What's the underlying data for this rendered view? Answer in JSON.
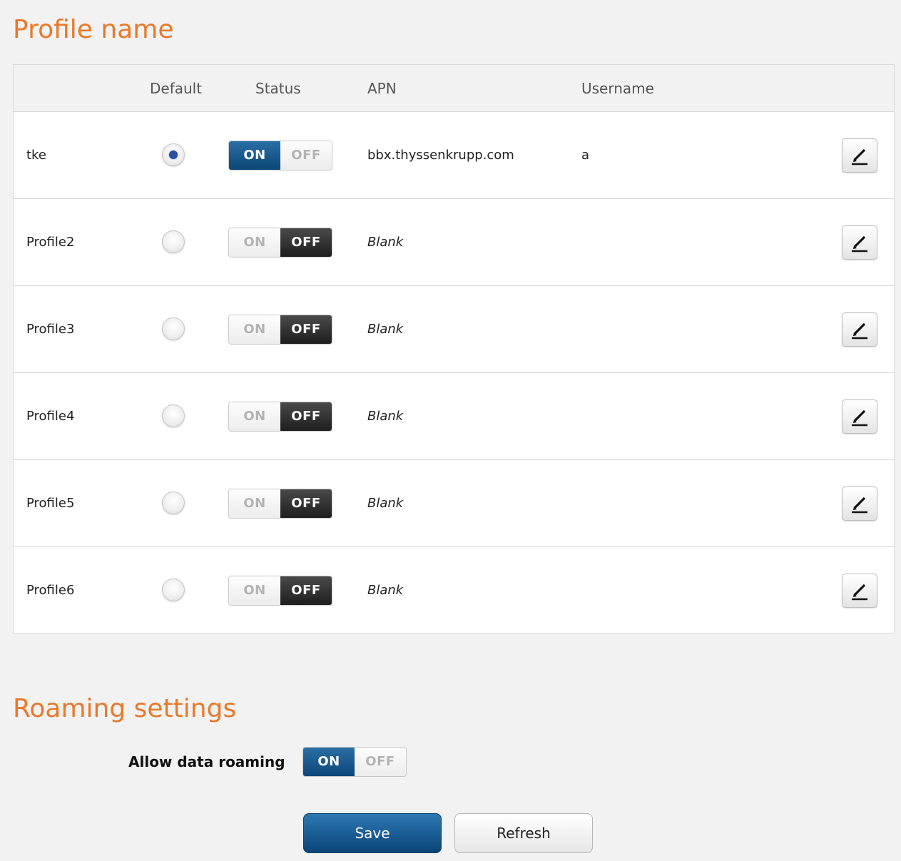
{
  "profiles_section": {
    "title": "Profile name",
    "columns": {
      "default": "Default",
      "status": "Status",
      "apn": "APN",
      "username": "Username"
    },
    "rows": [
      {
        "name": "tke",
        "default": true,
        "status": "ON",
        "apn": "bbx.thyssenkrupp.com",
        "apn_blank": false,
        "username": "a"
      },
      {
        "name": "Profile2",
        "default": false,
        "status": "OFF",
        "apn": "Blank",
        "apn_blank": true,
        "username": ""
      },
      {
        "name": "Profile3",
        "default": false,
        "status": "OFF",
        "apn": "Blank",
        "apn_blank": true,
        "username": ""
      },
      {
        "name": "Profile4",
        "default": false,
        "status": "OFF",
        "apn": "Blank",
        "apn_blank": true,
        "username": ""
      },
      {
        "name": "Profile5",
        "default": false,
        "status": "OFF",
        "apn": "Blank",
        "apn_blank": true,
        "username": ""
      },
      {
        "name": "Profile6",
        "default": false,
        "status": "OFF",
        "apn": "Blank",
        "apn_blank": true,
        "username": ""
      }
    ],
    "icon": "edit-pencil-icon"
  },
  "toggle_labels": {
    "on": "ON",
    "off": "OFF"
  },
  "roaming_section": {
    "title": "Roaming settings",
    "allow_label": "Allow data roaming",
    "allow_state": "ON"
  },
  "buttons": {
    "save": "Save",
    "refresh": "Refresh"
  },
  "colors": {
    "title": "#e8792a",
    "on_active": "#0c4778",
    "off_active": "#1e1e1e",
    "radio_dot": "#2a4fa3"
  }
}
